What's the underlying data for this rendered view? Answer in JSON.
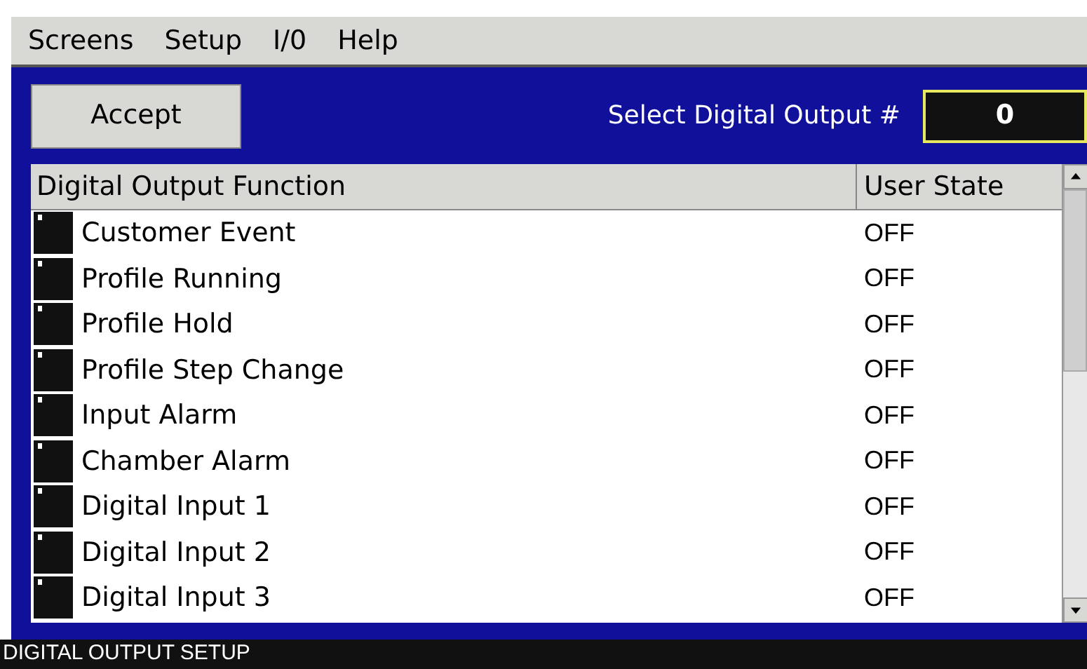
{
  "menu": [
    "Screens",
    "Setup",
    "I/0",
    "Help"
  ],
  "accept_button": "Accept",
  "select_label": "Select Digital Output #",
  "select_value": "0",
  "table": {
    "columns": [
      "Digital Output Function",
      "User State"
    ],
    "rows": [
      {
        "function": "Customer Event",
        "state": "OFF"
      },
      {
        "function": "Profile Running",
        "state": "OFF"
      },
      {
        "function": "Profile Hold",
        "state": "OFF"
      },
      {
        "function": "Profile Step Change",
        "state": "OFF"
      },
      {
        "function": "Input Alarm",
        "state": "OFF"
      },
      {
        "function": "Chamber Alarm",
        "state": "OFF"
      },
      {
        "function": "Digital Input 1",
        "state": "OFF"
      },
      {
        "function": "Digital Input 2",
        "state": "OFF"
      },
      {
        "function": "Digital Input 3",
        "state": "OFF"
      }
    ]
  },
  "status_bar": "DIGITAL OUTPUT SETUP"
}
